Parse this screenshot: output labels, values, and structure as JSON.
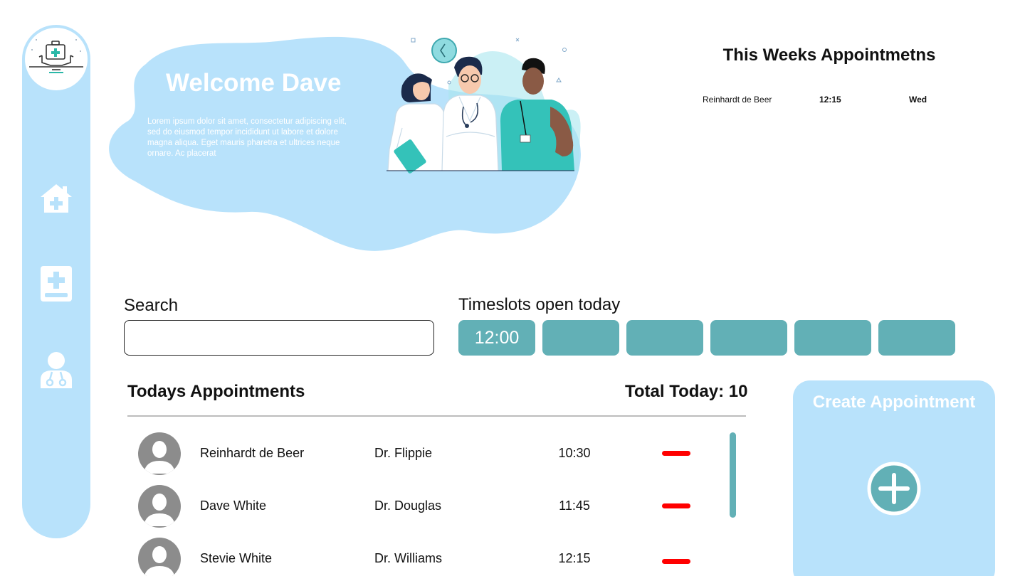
{
  "sidebar": {
    "logo_icon": "medical-monitor-logo",
    "items": [
      {
        "icon": "home-icon",
        "label": "Home"
      },
      {
        "icon": "medical-book-icon",
        "label": "Records"
      },
      {
        "icon": "doctor-icon",
        "label": "Doctors"
      }
    ]
  },
  "hero": {
    "title": "Welcome Dave",
    "body": "Lorem ipsum dolor sit amet, consectetur adipiscing elit, sed do eiusmod tempor incididunt ut labore et dolore magna aliqua. Eget mauris pharetra et ultrices neque ornare. Ac placerat",
    "illustration": "three-doctors-illustration"
  },
  "week": {
    "title": "This Weeks Appointmetns",
    "rows": [
      {
        "name": "Reinhardt de Beer",
        "time": "12:15",
        "day": "Wed"
      }
    ]
  },
  "search": {
    "label": "Search",
    "value": "",
    "placeholder": ""
  },
  "timeslots": {
    "label": "Timeslots open today",
    "slots": [
      "12:00",
      "",
      "",
      "",
      "",
      ""
    ]
  },
  "today": {
    "title": "Todays Appointments",
    "total_label": "Total Today: 10",
    "rows": [
      {
        "name": "Reinhardt de Beer",
        "doctor": "Dr. Flippie",
        "time": "10:30"
      },
      {
        "name": "Dave White",
        "doctor": "Dr. Douglas",
        "time": "11:45"
      },
      {
        "name": "Stevie White",
        "doctor": "Dr. Williams",
        "time": "12:15"
      }
    ]
  },
  "create": {
    "title": "Create Appointment",
    "icon": "plus-circle-icon"
  },
  "colors": {
    "light_blue": "#b8e2fb",
    "teal": "#62b0b6",
    "remove_red": "#ff0000",
    "avatar_gray": "#8c8c8c"
  }
}
